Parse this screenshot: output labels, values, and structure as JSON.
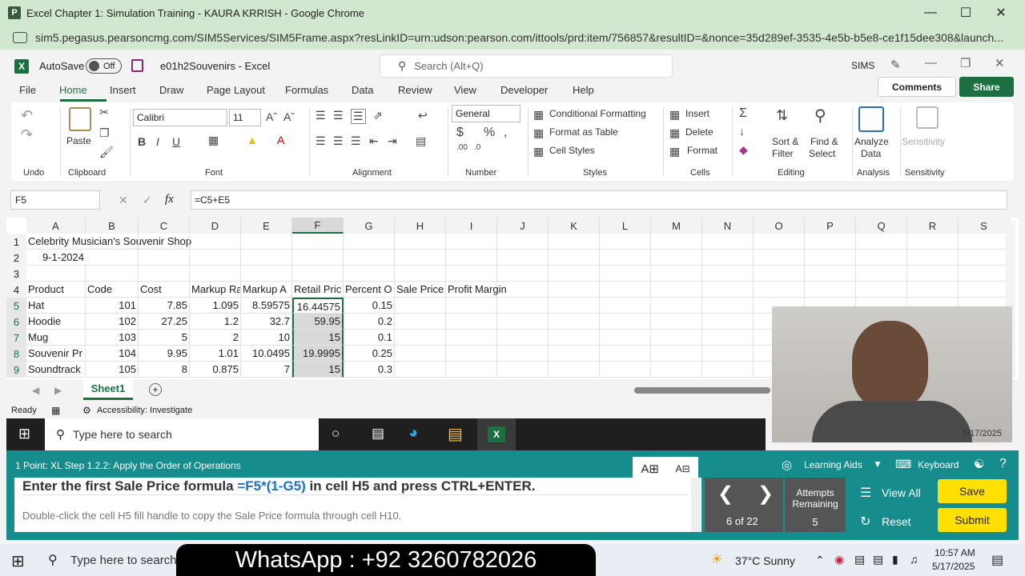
{
  "chrome": {
    "title": "Excel Chapter 1: Simulation Training - KAURA KRRISH - Google Chrome",
    "favicon_letter": "P",
    "url": "sim5.pegasus.pearsoncmg.com/SIM5Services/SIM5Frame.aspx?resLinkID=urn:udson:pearson.com/ittools/prd:item/756857&resultID=&nonce=35d289ef-3535-4e5b-b5e8-ce1f15dee308&launch..."
  },
  "excel_top": {
    "autosave_label": "AutoSave",
    "autosave_state": "Off",
    "file_name": "e01h2Souvenirs - Excel",
    "search_placeholder": "Search (Alt+Q)",
    "user": "SIMS"
  },
  "tabs": [
    "File",
    "Home",
    "Insert",
    "Draw",
    "Page Layout",
    "Formulas",
    "Data",
    "Review",
    "View",
    "Developer",
    "Help"
  ],
  "active_tab": "Home",
  "comments_label": "Comments",
  "share_label": "Share",
  "ribbon": {
    "undo_label": "Undo",
    "clipboard_label": "Clipboard",
    "paste_label": "Paste",
    "font_label": "Font",
    "font_name": "Calibri",
    "font_size": "11",
    "alignment_label": "Alignment",
    "number_label": "Number",
    "number_format": "General",
    "styles_label": "Styles",
    "conditional_formatting": "Conditional Formatting",
    "format_as_table": "Format as Table",
    "cell_styles": "Cell Styles",
    "cells_label": "Cells",
    "insert": "Insert",
    "delete": "Delete",
    "format": "Format",
    "editing_label": "Editing",
    "sort_filter_1": "Sort &",
    "sort_filter_2": "Filter",
    "find_select_1": "Find &",
    "find_select_2": "Select",
    "analysis_label": "Analysis",
    "analyze_data_1": "Analyze",
    "analyze_data_2": "Data",
    "sensitivity_label": "Sensitivity",
    "sensitivity_btn": "Sensitivity"
  },
  "formula_bar": {
    "name_box": "F5",
    "fx": "fx",
    "formula": "=C5+E5"
  },
  "columns": [
    "A",
    "B",
    "C",
    "D",
    "E",
    "F",
    "G",
    "H",
    "I",
    "J",
    "K",
    "L",
    "M",
    "N",
    "O",
    "P",
    "Q",
    "R",
    "S"
  ],
  "rows": [
    {
      "num": "1",
      "cells": [
        "Celebrity Musician's Souvenir Shop",
        "",
        "",
        "",
        "",
        "",
        "",
        "",
        ""
      ]
    },
    {
      "num": "2",
      "cells": [
        "9-1-2024",
        "",
        "",
        "",
        "",
        "",
        "",
        "",
        ""
      ]
    },
    {
      "num": "3",
      "cells": [
        "",
        "",
        "",
        "",
        "",
        "",
        "",
        "",
        ""
      ]
    },
    {
      "num": "4",
      "cells": [
        "Product",
        "Code",
        "Cost",
        "Markup Ra",
        "Markup A",
        "Retail Pric",
        "Percent O",
        "Sale Price",
        "Profit Margin"
      ]
    },
    {
      "num": "5",
      "cells": [
        "Hat",
        "101",
        "7.85",
        "1.095",
        "8.59575",
        "16.44575",
        "0.15",
        "",
        ""
      ]
    },
    {
      "num": "6",
      "cells": [
        "Hoodie",
        "102",
        "27.25",
        "1.2",
        "32.7",
        "59.95",
        "0.2",
        "",
        ""
      ]
    },
    {
      "num": "7",
      "cells": [
        "Mug",
        "103",
        "5",
        "2",
        "10",
        "15",
        "0.1",
        "",
        ""
      ]
    },
    {
      "num": "8",
      "cells": [
        "Souvenir Pr",
        "104",
        "9.95",
        "1.01",
        "10.0495",
        "19.9995",
        "0.25",
        "",
        ""
      ]
    },
    {
      "num": "9",
      "cells": [
        "Soundtrack",
        "105",
        "8",
        "0.875",
        "7",
        "15",
        "0.3",
        "",
        ""
      ]
    }
  ],
  "sheet_tab": "Sheet1",
  "status": {
    "ready": "Ready",
    "accessibility": "Accessibility: Investigate"
  },
  "taskbar1": {
    "search_placeholder": "Type here to search"
  },
  "footer": {
    "step": "1 Point: XL Step 1.2.2: Apply the Order of Operations",
    "instruction_pre": "Enter the first Sale Price formula ",
    "instruction_formula": "=F5*(1-G5)",
    "instruction_post": " in cell H5 and press CTRL+ENTER.",
    "sub_instruction": "Double-click the cell H5 fill handle to copy the Sale Price formula through cell H10.",
    "learning_aids": "Learning Aids",
    "keyboard": "Keyboard",
    "progress": "6 of 22",
    "attempts_label_1": "Attempts",
    "attempts_label_2": "Remaining",
    "attempts_value": "5",
    "view_all": "View All",
    "reset": "Reset",
    "save": "Save",
    "submit": "Submit"
  },
  "taskbar2": {
    "search_placeholder": "Type here to search",
    "banner": "WhatsApp : +92 3260782026",
    "weather": "37°C  Sunny",
    "time": "10:57 AM",
    "date": "5/17/2025",
    "webcam_date": "5/17/2025"
  },
  "colors": {
    "excel_green": "#1d6f42",
    "chrome_bar": "#d2e7cf",
    "footer_teal": "#178c8c",
    "save_yellow": "#ffe000"
  }
}
